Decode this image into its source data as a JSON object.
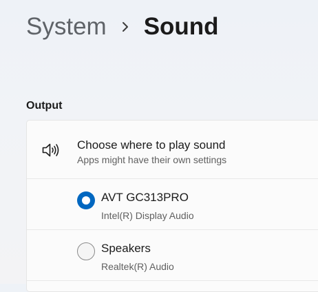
{
  "breadcrumb": {
    "parent": "System",
    "separator_icon": "chevron-right-icon",
    "current": "Sound"
  },
  "output": {
    "section_title": "Output",
    "header": {
      "icon": "speaker-icon",
      "title": "Choose where to play sound",
      "subtitle": "Apps might have their own settings"
    },
    "devices": [
      {
        "name": "AVT GC313PRO",
        "description": "Intel(R) Display Audio",
        "selected": true
      },
      {
        "name": "Speakers",
        "description": "Realtek(R) Audio",
        "selected": false
      }
    ]
  },
  "colors": {
    "accent": "#0067c0",
    "text_primary": "#1b1b1b",
    "text_secondary": "#5f5f5f",
    "card_background": "#fbfbfb"
  }
}
